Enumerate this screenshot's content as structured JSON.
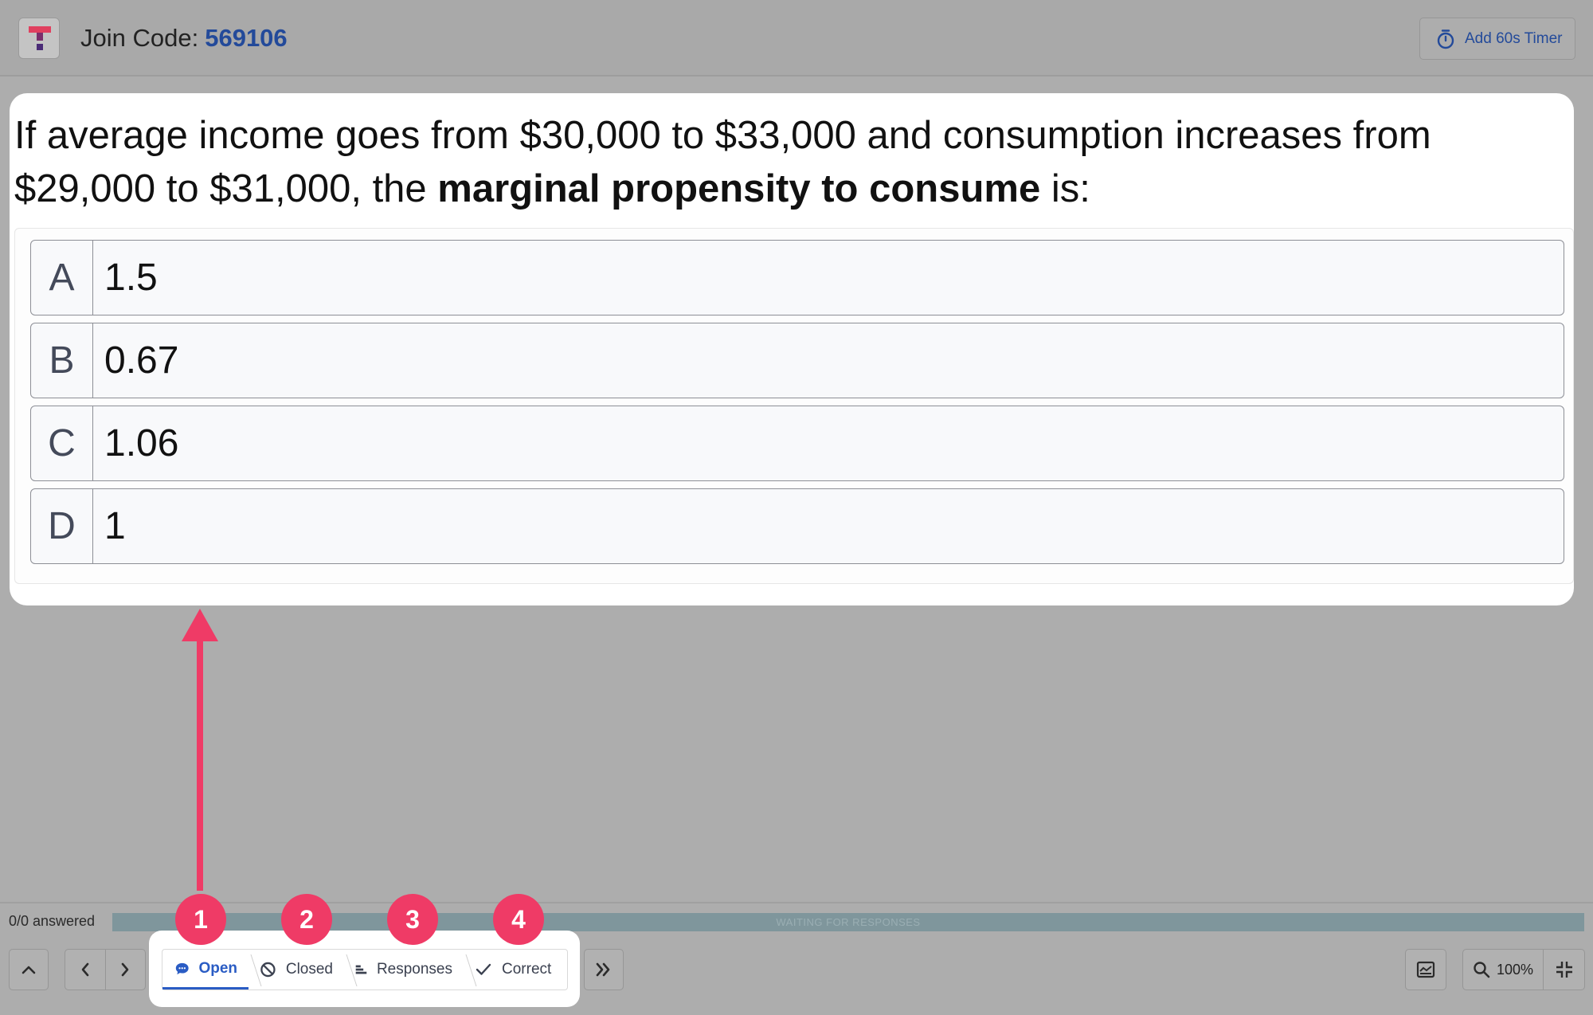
{
  "header": {
    "join_label": "Join Code:",
    "join_code": "569106",
    "timer_label": "Add 60s Timer"
  },
  "question": {
    "text_before": "If average income goes from $30,000 to $33,000 and consumption increases from $29,000 to $31,000, the ",
    "text_bold": "marginal propensity to consume",
    "text_after": " is:"
  },
  "choices": [
    {
      "letter": "A",
      "text": "1.5"
    },
    {
      "letter": "B",
      "text": "0.67"
    },
    {
      "letter": "C",
      "text": "1.06"
    },
    {
      "letter": "D",
      "text": "1"
    }
  ],
  "status": {
    "answered": "0/0 answered",
    "progress_label": "WAITING FOR RESPONSES"
  },
  "steps": [
    {
      "label": "Open",
      "icon": "chat-bubble-icon",
      "badge": "1"
    },
    {
      "label": "Closed",
      "icon": "ban-icon",
      "badge": "2"
    },
    {
      "label": "Responses",
      "icon": "bar-chart-icon",
      "badge": "3"
    },
    {
      "label": "Correct",
      "icon": "check-icon",
      "badge": "4"
    }
  ],
  "toolbar": {
    "zoom": "100%"
  },
  "colors": {
    "accent": "#2a5cc4",
    "annotation": "#ef3b66"
  }
}
